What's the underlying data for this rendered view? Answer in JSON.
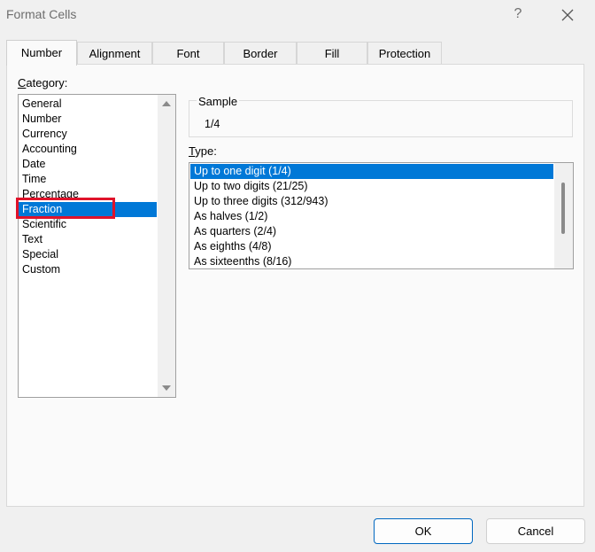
{
  "window": {
    "title": "Format Cells",
    "help_label": "?"
  },
  "tabs": [
    {
      "label": "Number",
      "active": true
    },
    {
      "label": "Alignment"
    },
    {
      "label": "Font"
    },
    {
      "label": "Border"
    },
    {
      "label": "Fill"
    },
    {
      "label": "Protection"
    }
  ],
  "category": {
    "label_accel": "C",
    "label_rest": "ategory:",
    "selected": "Fraction",
    "items": [
      "General",
      "Number",
      "Currency",
      "Accounting",
      "Date",
      "Time",
      "Percentage",
      "Fraction",
      "Scientific",
      "Text",
      "Special",
      "Custom"
    ]
  },
  "sample": {
    "label": "Sample",
    "value": "1/4"
  },
  "type": {
    "label_accel": "T",
    "label_rest": "ype:",
    "selected": "Up to one digit (1/4)",
    "items": [
      "Up to one digit (1/4)",
      "Up to two digits (21/25)",
      "Up to three digits (312/943)",
      "As halves (1/2)",
      "As quarters (2/4)",
      "As eighths (4/8)",
      "As sixteenths (8/16)"
    ]
  },
  "buttons": {
    "ok_label": "OK",
    "cancel_label": "Cancel"
  },
  "colors": {
    "selection": "#0078d7",
    "highlight_box": "#e0132b",
    "ok_border": "#0067c0"
  }
}
